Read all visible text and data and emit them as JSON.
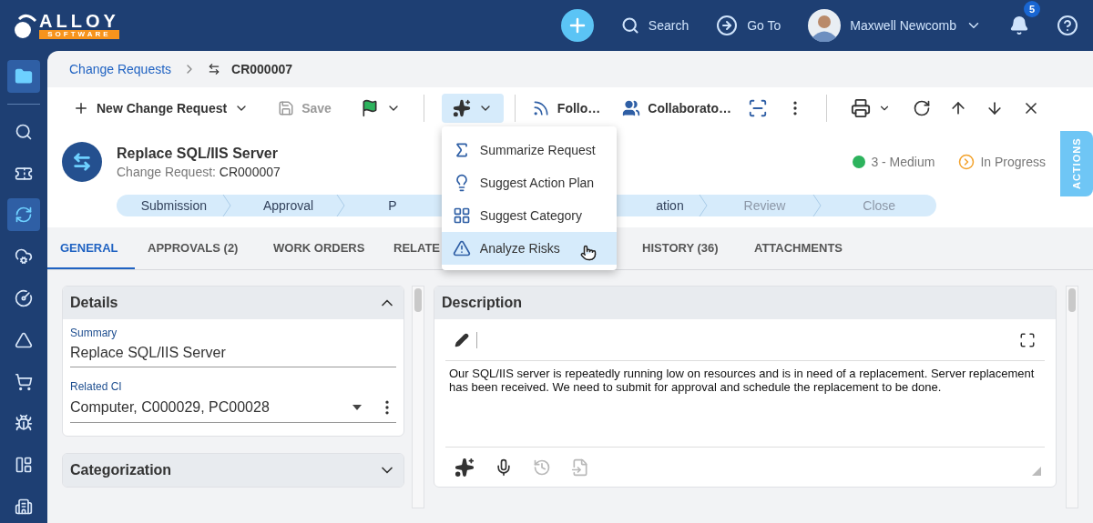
{
  "top_bar": {
    "logo": {
      "name": "ALLOY",
      "tagline": "SOFTWARE"
    },
    "search": "Search",
    "go_to": "Go To",
    "user": "Maxwell Newcomb",
    "notifications": "5"
  },
  "sidebar": {
    "items": [
      {
        "selected": true
      },
      {
        "selected": false
      },
      {
        "selected": false
      },
      {
        "selected": true
      },
      {
        "selected": false
      },
      {
        "selected": false
      },
      {
        "selected": false
      },
      {
        "selected": false
      },
      {
        "selected": false
      },
      {
        "selected": false
      },
      {
        "selected": false
      }
    ]
  },
  "breadcrumb": [
    {
      "label": "Change Requests",
      "kind": "link"
    },
    {
      "label": "CR000007",
      "kind": "current"
    }
  ],
  "toolbar": {
    "new": "New Change Request",
    "save": {
      "label": "Save",
      "disabled": true
    },
    "ai_menu_open": true,
    "follow": "Follo…",
    "collaborators": "Collaborato…"
  },
  "ai_menu": [
    {
      "label": "Summarize Request",
      "selected": false
    },
    {
      "label": "Suggest Action Plan",
      "selected": false
    },
    {
      "label": "Suggest Category",
      "selected": false
    },
    {
      "label": "Analyze Risks",
      "selected": true
    }
  ],
  "record": {
    "title": "Replace SQL/IIS Server",
    "type_label": "Change Request:",
    "number": "CR000007",
    "priority": {
      "label": "3 - Medium",
      "color": "#2db35d"
    },
    "status": "In Progress",
    "actions": "ACTIONS"
  },
  "stages": [
    {
      "label": "Submission",
      "done": true
    },
    {
      "label": "Approval",
      "done": true
    },
    {
      "label": "P",
      "done": true
    },
    {
      "label": "ation",
      "done": true
    },
    {
      "label": "Review",
      "done": false
    },
    {
      "label": "Close",
      "done": false
    }
  ],
  "tabs": [
    {
      "label": "GENERAL",
      "selected": true
    },
    {
      "label": "APPROVALS (2)",
      "selected": false
    },
    {
      "label": "WORK ORDERS",
      "selected": false
    },
    {
      "label": "RELATE",
      "selected": false
    },
    {
      "label": "HISTORY (36)",
      "selected": false
    },
    {
      "label": "ATTACHMENTS",
      "selected": false
    }
  ],
  "details": {
    "title": "Details",
    "expanded": true,
    "fields": [
      {
        "label": "Summary",
        "value": "Replace SQL/IIS Server",
        "kind": "text"
      },
      {
        "label": "Related CI",
        "value": "Computer, C000029, PC00028",
        "kind": "select"
      }
    ]
  },
  "categorization": {
    "title": "Categorization",
    "expanded": false
  },
  "description": {
    "title": "Description",
    "text": "Our SQL/IIS server is repeatedly running low on resources and is in need of a replacement. Server replacement has been received. We need to submit for approval and schedule the replacement to be done."
  }
}
